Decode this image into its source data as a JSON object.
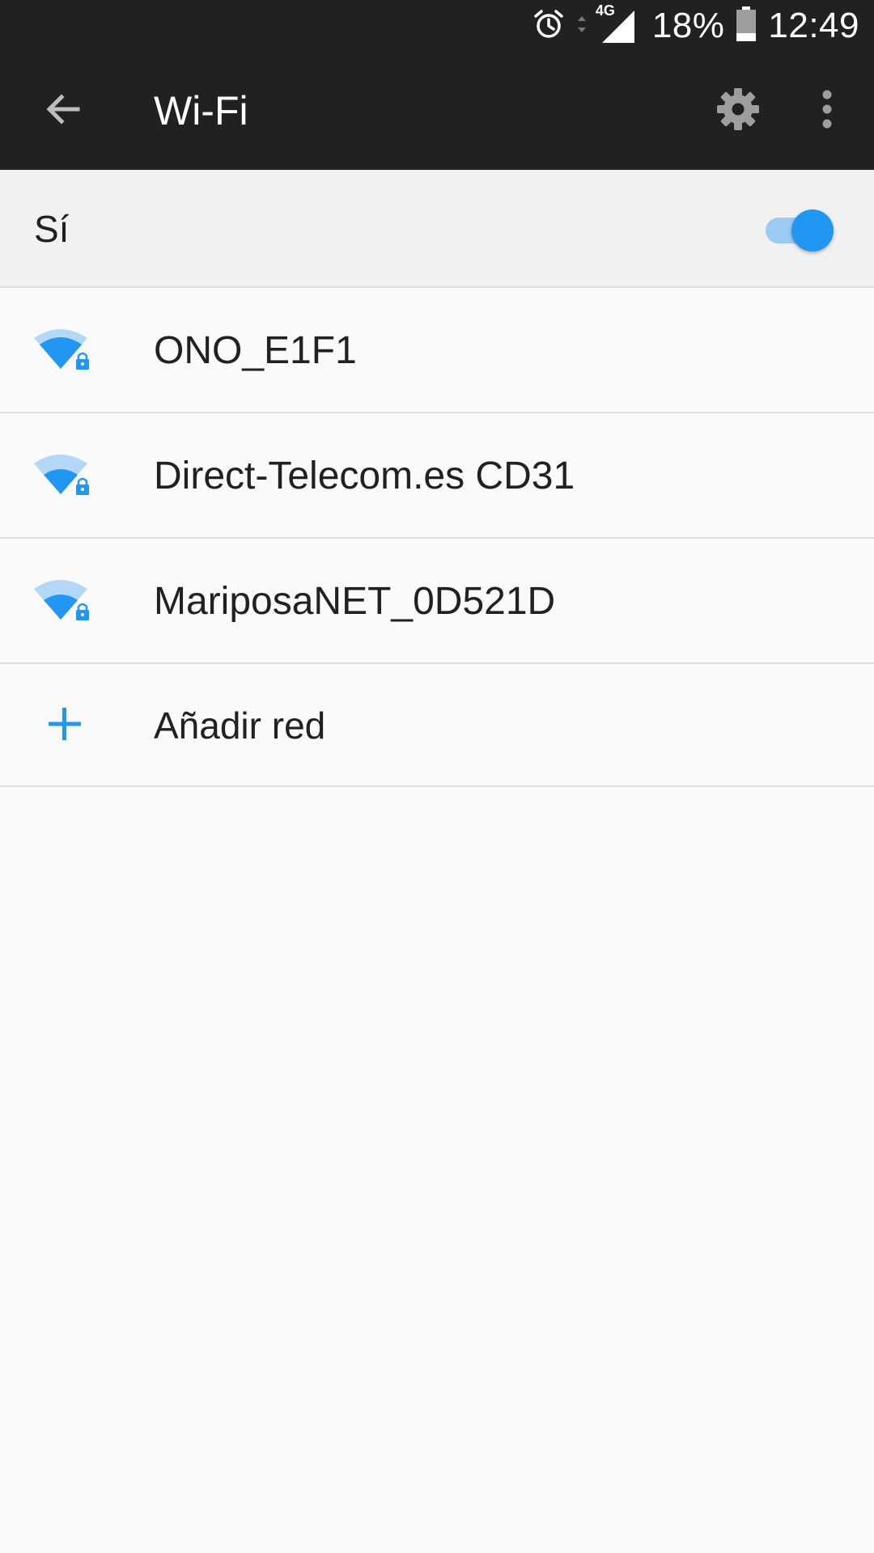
{
  "status_bar": {
    "network_type": "4G",
    "battery": "18%",
    "time": "12:49",
    "icons": [
      "alarm-icon",
      "data-arrows-icon",
      "cell-signal-icon",
      "battery-icon"
    ]
  },
  "app_bar": {
    "title": "Wi-Fi",
    "icons": [
      "back-arrow-icon",
      "gear-icon",
      "more-vert-icon"
    ]
  },
  "master_toggle": {
    "label": "Sí",
    "state": "on"
  },
  "networks": [
    {
      "name": "ONO_E1F1",
      "secured": true,
      "signal_level": 0.7,
      "icon": "wifi-lock-icon"
    },
    {
      "name": "Direct-Telecom.es CD31",
      "secured": true,
      "signal_level": 0.55,
      "icon": "wifi-lock-icon"
    },
    {
      "name": "MariposaNET_0D521D",
      "secured": true,
      "signal_level": 0.55,
      "icon": "wifi-lock-icon"
    }
  ],
  "add_network": {
    "label": "Añadir red",
    "icon": "plus-icon"
  },
  "colors": {
    "accent": "#2196f3",
    "accent_light": "#b3d8f7",
    "bar_bg": "#212121",
    "row_bg": "#fafafa",
    "toggle_row_bg": "#f1f1f1",
    "divider": "#e0e0e0",
    "text_primary": "#212121"
  }
}
